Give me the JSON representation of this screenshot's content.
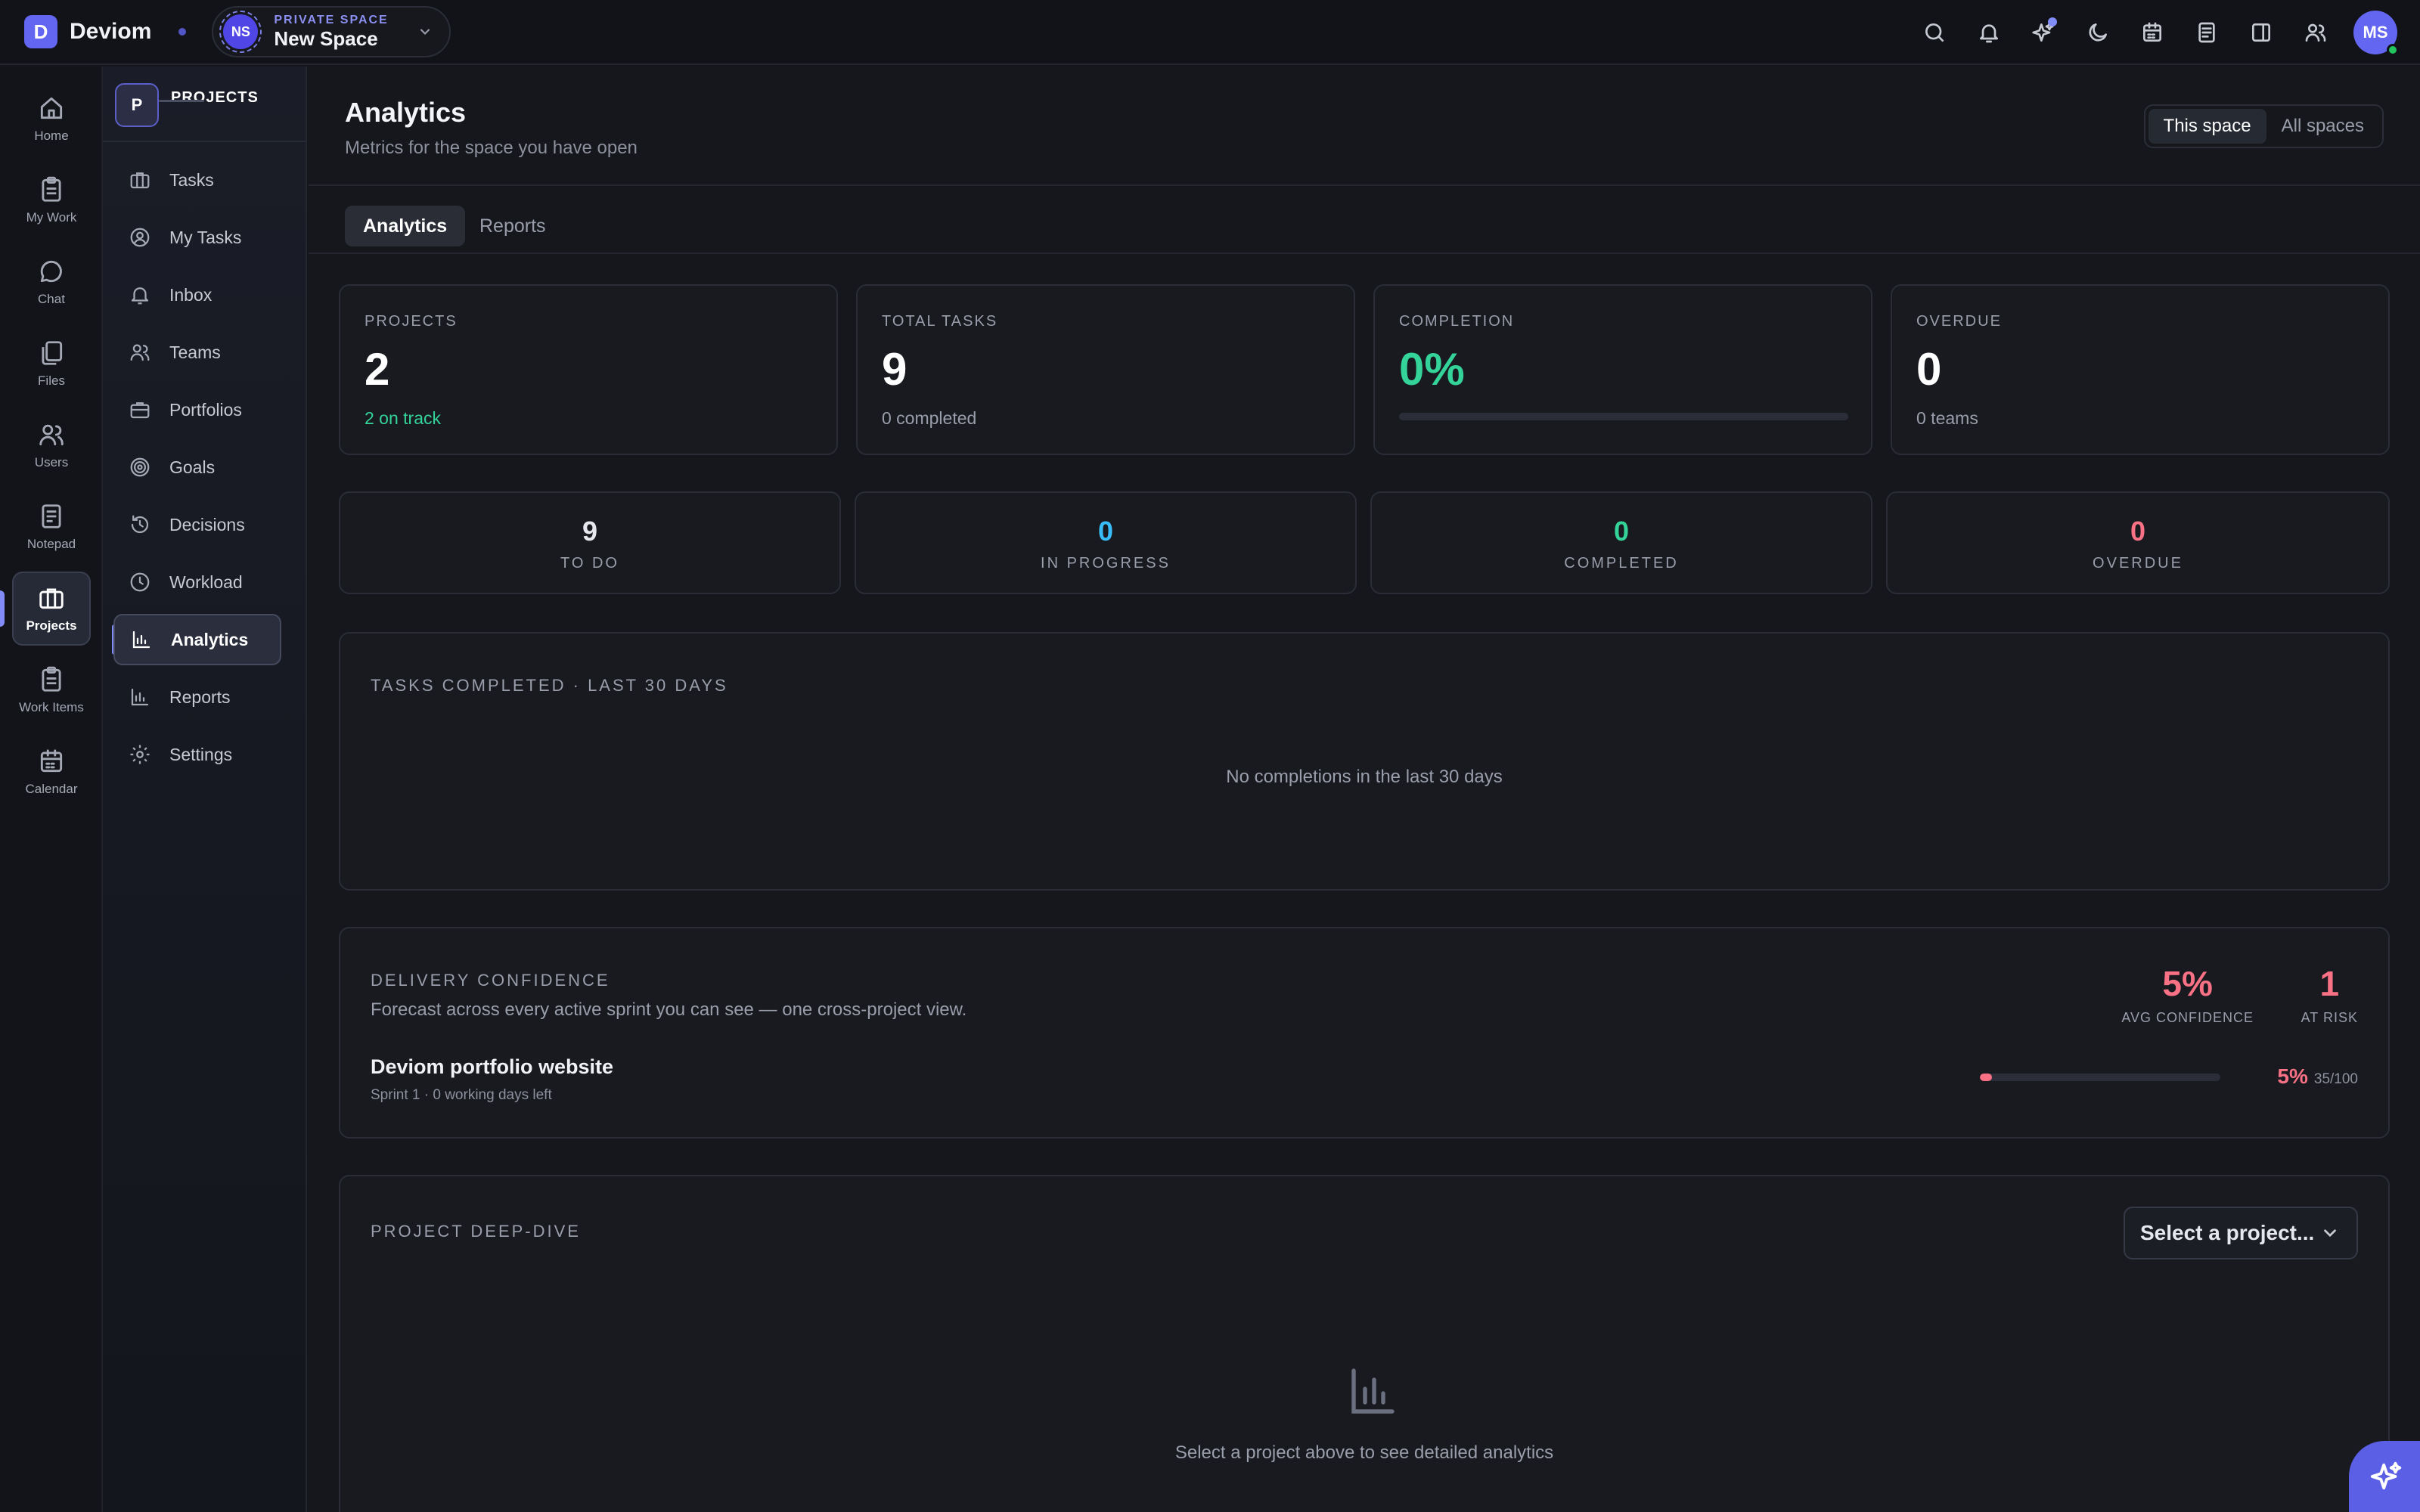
{
  "app": {
    "logo_letter": "D",
    "name": "Deviom"
  },
  "space": {
    "kicker": "PRIVATE SPACE",
    "name": "New Space",
    "initials": "NS"
  },
  "user": {
    "initials": "MS"
  },
  "rail": [
    {
      "label": "Home",
      "icon": "home-icon"
    },
    {
      "label": "My Work",
      "icon": "clipboard-icon"
    },
    {
      "label": "Chat",
      "icon": "chat-bubble-icon"
    },
    {
      "label": "Files",
      "icon": "files-icon"
    },
    {
      "label": "Users",
      "icon": "users-icon"
    },
    {
      "label": "Notepad",
      "icon": "notepad-icon"
    },
    {
      "label": "Projects",
      "icon": "briefcase-icon",
      "active": true
    },
    {
      "label": "Work Items",
      "icon": "clipboard-list-icon"
    },
    {
      "label": "Calendar",
      "icon": "calendar-icon"
    }
  ],
  "sidebar": {
    "logo_letter": "P",
    "title": "PROJECTS",
    "items": [
      {
        "label": "Tasks",
        "icon": "briefcase-icon"
      },
      {
        "label": "My Tasks",
        "icon": "user-circle-icon"
      },
      {
        "label": "Inbox",
        "icon": "bell-icon"
      },
      {
        "label": "Teams",
        "icon": "users-icon"
      },
      {
        "label": "Portfolios",
        "icon": "portfolio-icon"
      },
      {
        "label": "Goals",
        "icon": "target-icon"
      },
      {
        "label": "Decisions",
        "icon": "history-icon"
      },
      {
        "label": "Workload",
        "icon": "clock-icon"
      },
      {
        "label": "Analytics",
        "icon": "bar-chart-icon",
        "active": true
      },
      {
        "label": "Reports",
        "icon": "bar-chart-icon"
      },
      {
        "label": "Settings",
        "icon": "gear-icon"
      }
    ]
  },
  "page": {
    "title": "Analytics",
    "subtitle": "Metrics for the space you have open",
    "scope": {
      "this": "This space",
      "all": "All spaces"
    },
    "tabs": [
      "Analytics",
      "Reports"
    ]
  },
  "kpis": [
    {
      "label": "PROJECTS",
      "value": "2",
      "sub": "2 on track"
    },
    {
      "label": "TOTAL TASKS",
      "value": "9",
      "sub": "0 completed"
    },
    {
      "label": "COMPLETION",
      "value": "0%",
      "progress": 0
    },
    {
      "label": "OVERDUE",
      "value": "0",
      "sub": "0 teams"
    }
  ],
  "status": [
    {
      "value": "9",
      "label": "TO DO"
    },
    {
      "value": "0",
      "label": "IN PROGRESS"
    },
    {
      "value": "0",
      "label": "COMPLETED"
    },
    {
      "value": "0",
      "label": "OVERDUE"
    }
  ],
  "completed_chart": {
    "title": "TASKS COMPLETED · LAST 30 DAYS",
    "empty": "No completions in the last 30 days"
  },
  "delivery": {
    "title": "DELIVERY CONFIDENCE",
    "desc": "Forecast across every active sprint you can see — one cross-project view.",
    "avg_value": "5%",
    "avg_label": "AVG CONFIDENCE",
    "risk_value": "1",
    "risk_label": "AT RISK",
    "project": {
      "name": "Deviom portfolio website",
      "meta": "Sprint 1 · 0 working days left",
      "pct": "5%",
      "score": "35/100",
      "confidence": 5
    }
  },
  "deep_dive": {
    "title": "PROJECT DEEP-DIVE",
    "select": "Select a project...",
    "empty": "Select a project above to see detailed analytics"
  },
  "colors": {
    "accent": "#6366f1",
    "success": "#34d399",
    "info": "#38bdf8",
    "danger": "#f87185"
  }
}
